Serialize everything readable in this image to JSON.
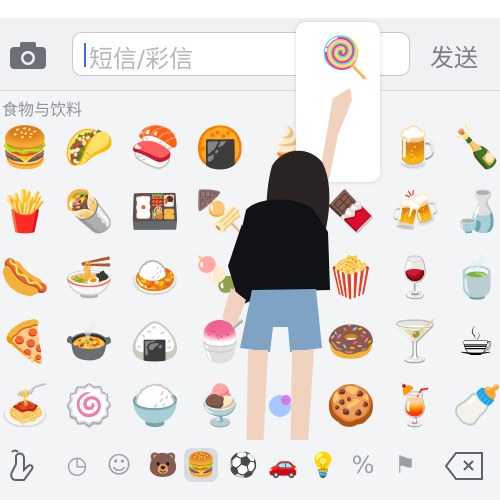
{
  "message": {
    "placeholder": "短信/彩信",
    "send_label": "发送"
  },
  "keyboard": {
    "category": "食物与饮料",
    "preview_emoji": "🍭",
    "rows": [
      [
        "🍔",
        "🌮",
        "🍣",
        "🍘",
        "🍦",
        "🍺",
        "🍾"
      ],
      [
        "🍟",
        "🌯",
        "🍱",
        "🍢",
        "🍫",
        "🍻",
        "🍶"
      ],
      [
        "🌭",
        "🍜",
        "🍛",
        "🍡",
        "🍿",
        "🍷",
        "🍵"
      ],
      [
        "🍕",
        "🍲",
        "🍙",
        "🍧",
        "🍩",
        "🍸",
        "☕"
      ],
      [
        "🍝",
        "🍥",
        "🍚",
        "🍨",
        "🍪",
        "🍹",
        "🍼"
      ]
    ],
    "tab_icons": [
      "gesture-icon",
      "clock-icon",
      "smiley-icon",
      "bear-icon",
      "food-icon",
      "ball-icon",
      "car-icon",
      "bulb-icon",
      "symbols-icon",
      "flag-icon",
      "delete-icon"
    ]
  }
}
